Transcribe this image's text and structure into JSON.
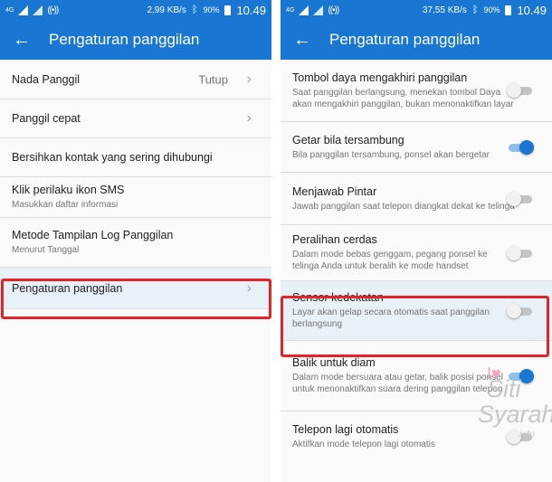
{
  "left": {
    "status": {
      "network": "4G",
      "speed": "2,99 KB/s",
      "battery": "90%",
      "time": "10.49"
    },
    "appbar": {
      "title": "Pengaturan panggilan"
    },
    "items": [
      {
        "title": "Nada Panggil",
        "value": "Tutup"
      },
      {
        "title": "Panggil cepat"
      },
      {
        "title": "Bersihkan kontak yang sering dihubungi"
      },
      {
        "title": "Klik perilaku ikon SMS",
        "subtitle": "Masukkan daftar informasi"
      },
      {
        "title": "Metode Tampilan Log Panggilan",
        "subtitle": "Menurut Tanggal"
      },
      {
        "title": "Pengaturan panggilan"
      }
    ]
  },
  "right": {
    "status": {
      "network": "4G",
      "speed": "37,55 KB/s",
      "battery": "90%",
      "time": "10.49"
    },
    "appbar": {
      "title": "Pengaturan panggilan"
    },
    "items": [
      {
        "title": "Tombol daya mengakhiri panggilan",
        "subtitle": "Saat panggilan berlangsung, menekan tombol Daya akan mengakhiri panggilan, bukan menonaktifkan layar",
        "on": false
      },
      {
        "title": "Getar bila tersambung",
        "subtitle": "Bila panggilan tersambung, ponsel akan bergetar",
        "on": true
      },
      {
        "title": "Menjawab Pintar",
        "subtitle": "Jawab panggilan saat telepon diangkat dekat ke telinga",
        "on": false
      },
      {
        "title": "Peralihan cerdas",
        "subtitle": "Dalam mode bebas genggam, pegang ponsel ke telinga Anda untuk beralih ke mode handset",
        "on": false
      },
      {
        "title": "Sensor kedekatan",
        "subtitle": "Layar akan gelap secara otomatis saat panggilan berlangsung",
        "on": false
      },
      {
        "title": "Balik untuk diam",
        "subtitle": "Dalam mode bersuara atau getar, balik posisi ponsel untuk menonaktifkan suara dering panggilan telepon",
        "on": true
      },
      {
        "title": "Telepon lagi otomatis",
        "subtitle": "Aktifkan mode telepon lagi otomatis",
        "on": false
      }
    ]
  },
  "watermark": {
    "line1": "Siti",
    "line2": "Syarah",
    "line3": ".info"
  },
  "colors": {
    "primary": "#1976d2",
    "highlight_border": "#e2232a"
  }
}
